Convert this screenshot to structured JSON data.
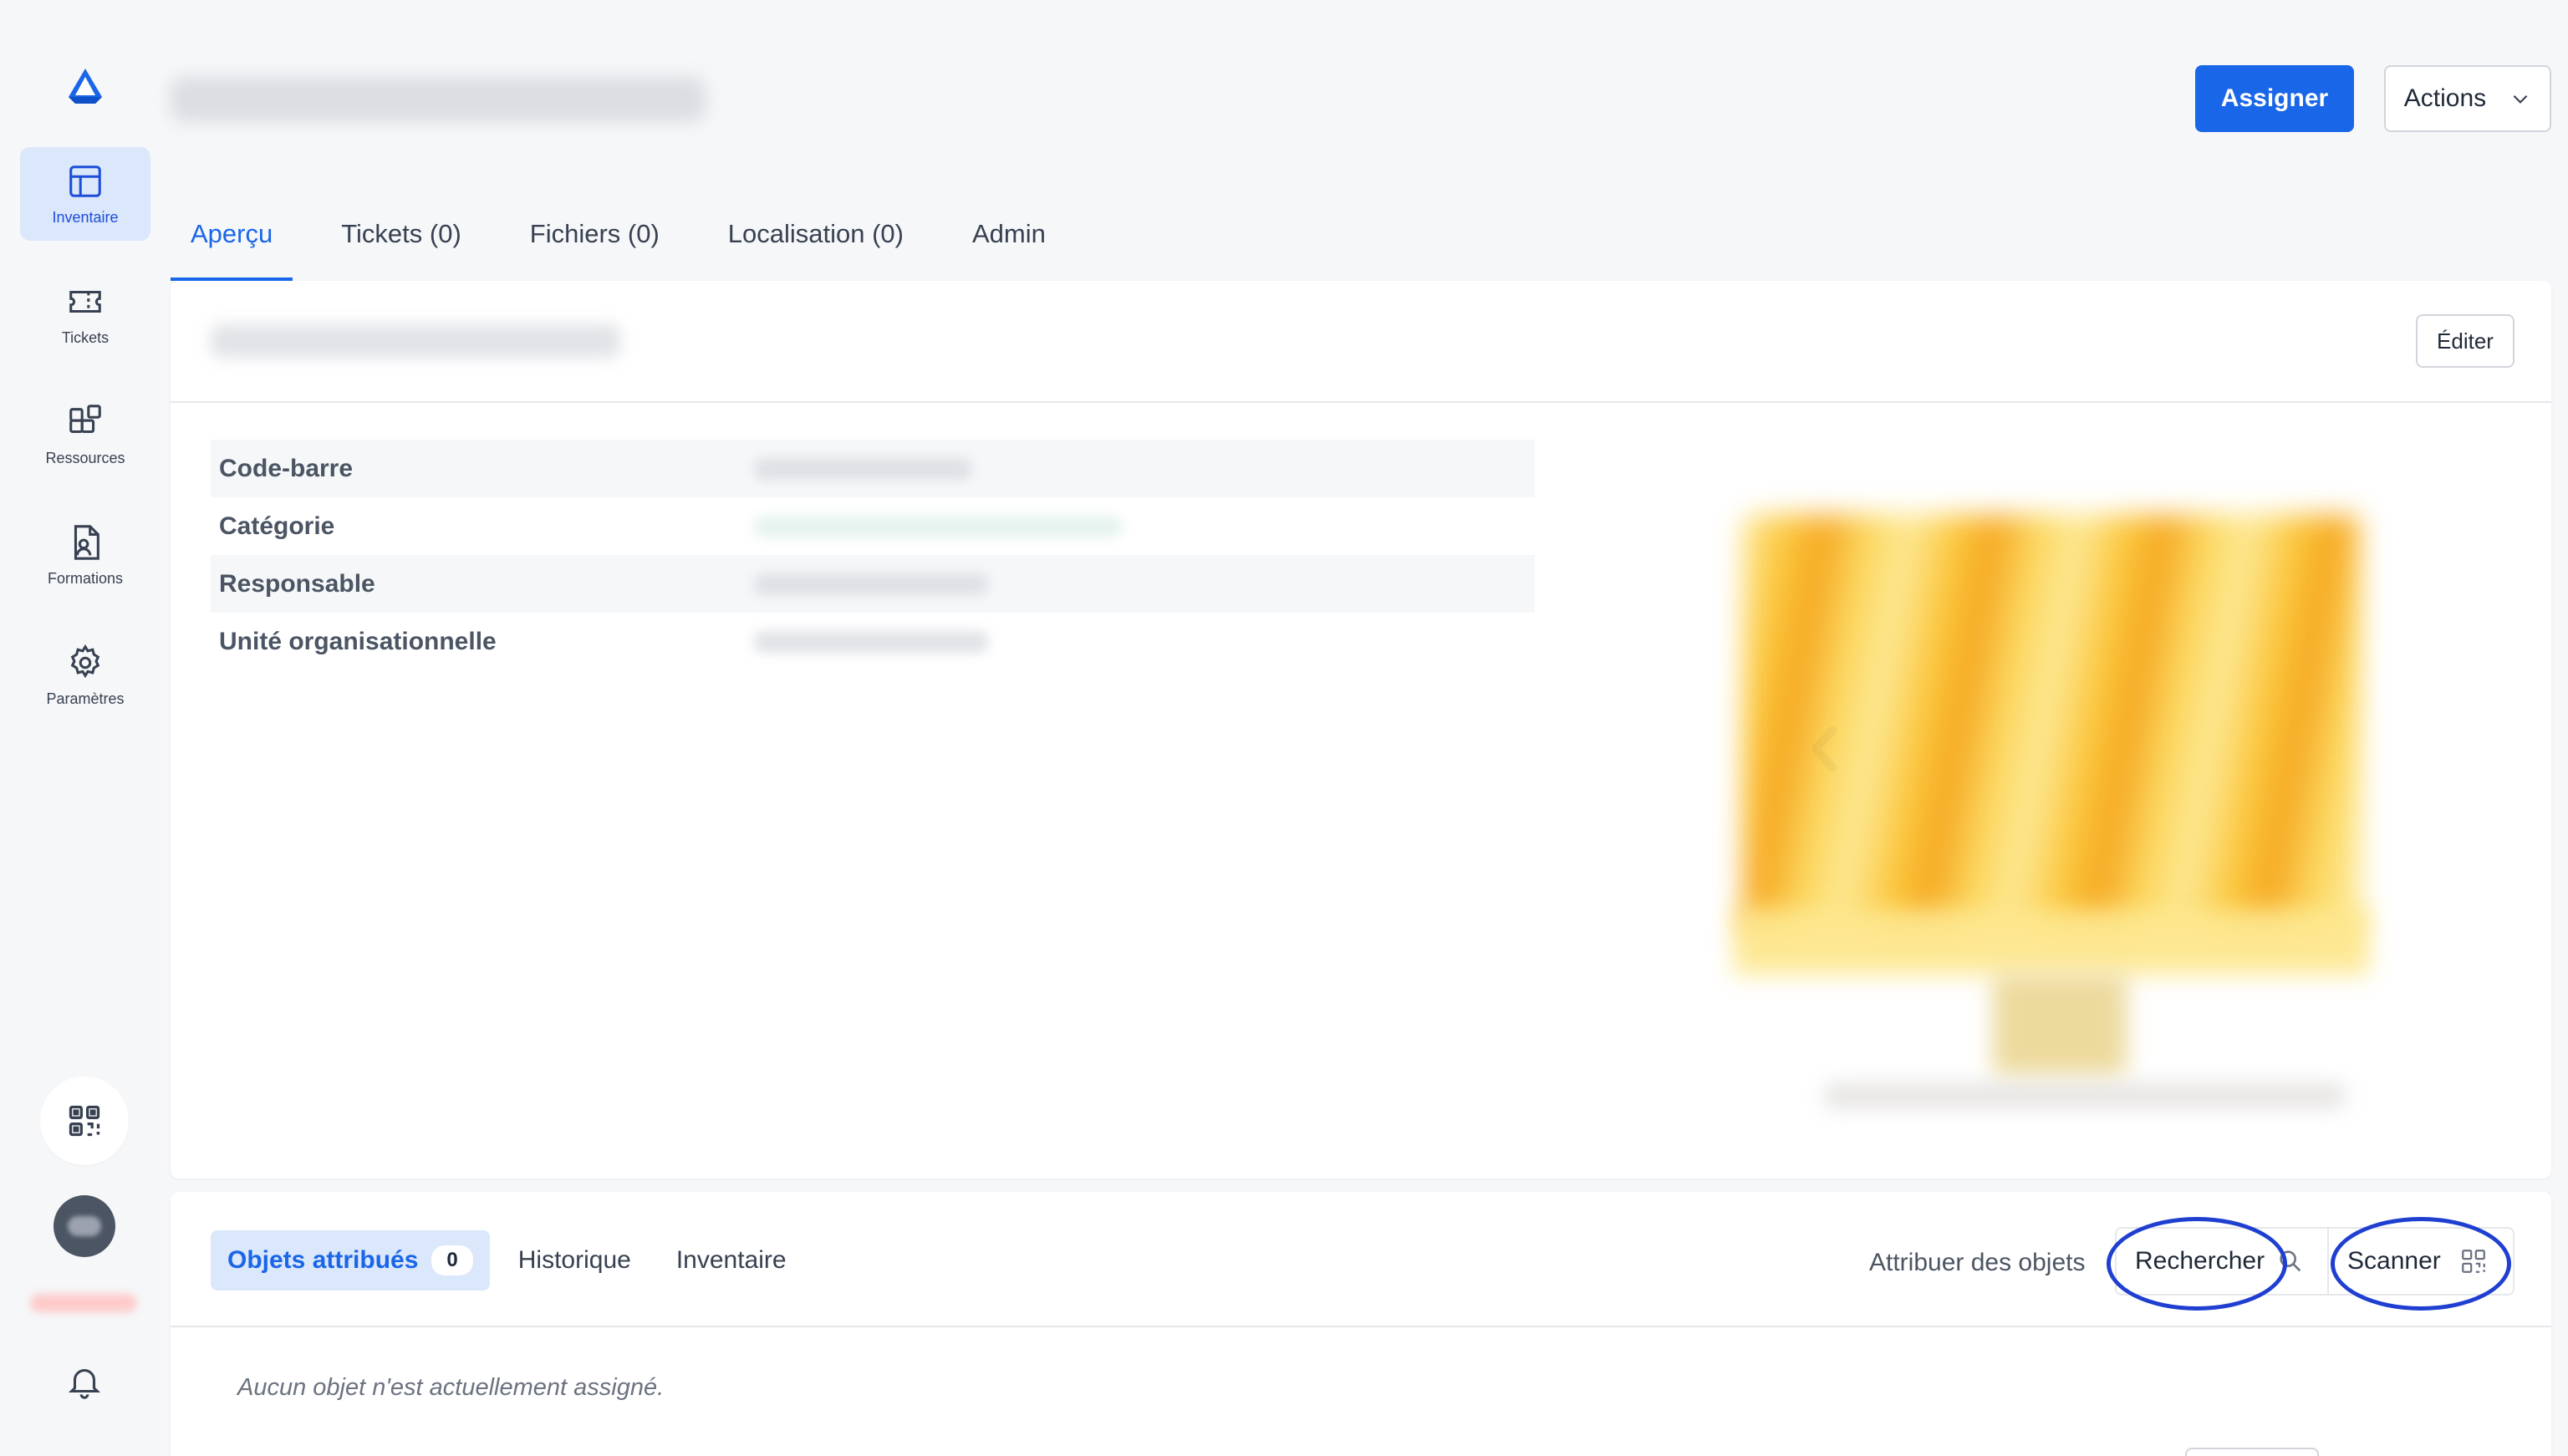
{
  "sidebar": {
    "items": [
      {
        "label": "Inventaire",
        "icon": "table-icon",
        "active": true
      },
      {
        "label": "Tickets",
        "icon": "ticket-icon",
        "active": false
      },
      {
        "label": "Ressources",
        "icon": "resources-icon",
        "active": false
      },
      {
        "label": "Formations",
        "icon": "document-user-icon",
        "active": false
      },
      {
        "label": "Paramètres",
        "icon": "gear-icon",
        "active": false
      }
    ]
  },
  "header": {
    "assign_label": "Assigner",
    "actions_label": "Actions"
  },
  "tabs": [
    {
      "label": "Aperçu",
      "active": true
    },
    {
      "label": "Tickets (0)",
      "active": false
    },
    {
      "label": "Fichiers (0)",
      "active": false
    },
    {
      "label": "Localisation (0)",
      "active": false
    },
    {
      "label": "Admin",
      "active": false
    }
  ],
  "card": {
    "edit_label": "Éditer",
    "fields": [
      {
        "label": "Code-barre"
      },
      {
        "label": "Catégorie"
      },
      {
        "label": "Responsable"
      },
      {
        "label": "Unité organisationnelle"
      }
    ]
  },
  "panel": {
    "subtabs": [
      {
        "label": "Objets attribués",
        "count": "0",
        "active": true
      },
      {
        "label": "Historique",
        "active": false
      },
      {
        "label": "Inventaire",
        "active": false
      }
    ],
    "assign_objects_label": "Attribuer des objets",
    "search_label": "Rechercher",
    "scan_label": "Scanner",
    "empty_message": "Aucun objet n'est actuellement assigné."
  },
  "colors": {
    "accent": "#1a66e8",
    "active_bg": "#dbe7fb",
    "annotation_ring": "#1f3fd1"
  }
}
